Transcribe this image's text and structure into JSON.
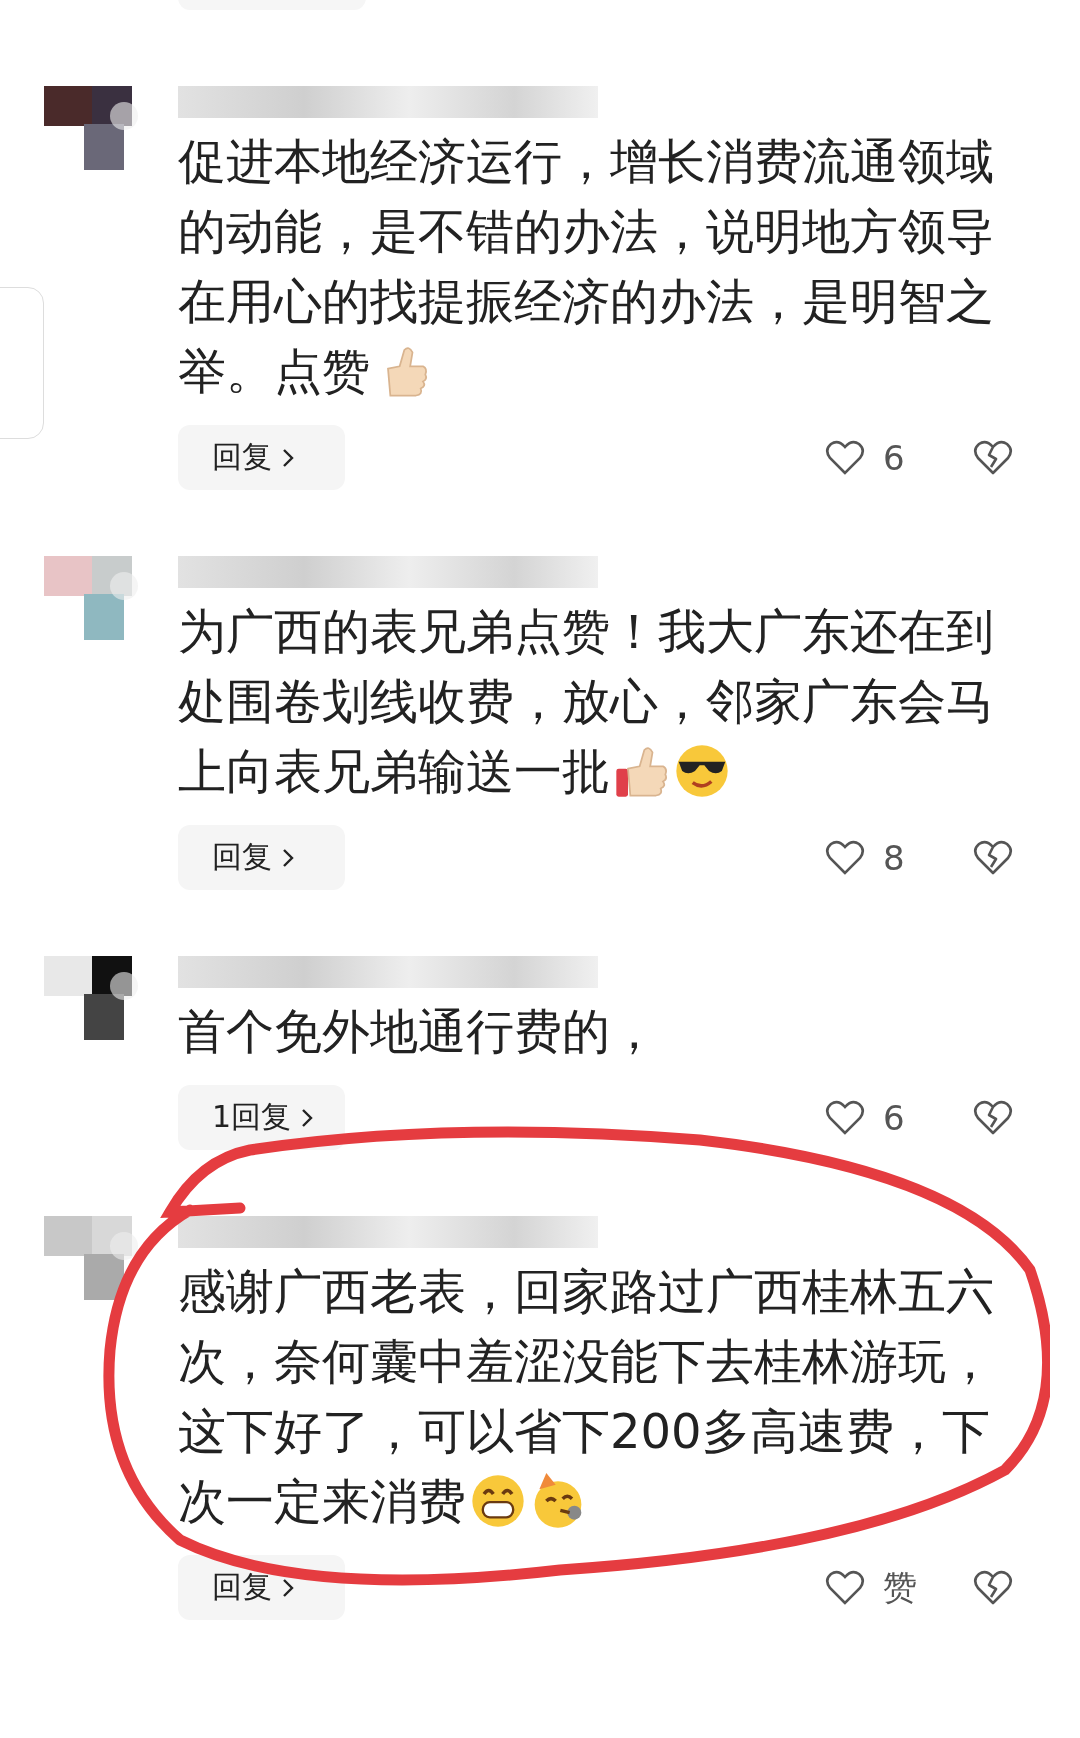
{
  "comments": [
    {
      "lines": [
        "促进本地经济运行，增长消费流通领域",
        "的动能，是不错的办法，说明地方领导",
        "在用心的找提振经济的办法，是明智之",
        "举。点赞"
      ],
      "emojis": [
        {
          "kind": "thumbs-up"
        }
      ],
      "reply": "回复",
      "likes": "6"
    },
    {
      "lines": [
        "为广西的表兄弟点赞！我大广东还在到",
        "处围卷划线收费，放心，邻家广东会马",
        "上向表兄弟输送一批"
      ],
      "emojis": [
        {
          "kind": "thumbs-up"
        },
        {
          "kind": "sunglasses"
        }
      ],
      "reply": "回复",
      "likes": "8"
    },
    {
      "lines": [
        "首个免外地通行费的，"
      ],
      "reply": "1回复",
      "likes": "6"
    },
    {
      "lines": [
        "感谢广西老表，回家路过广西桂林五六",
        "次，奈何囊中羞涩没能下去桂林游玩，",
        "这下好了，可以省下200多高速费，下",
        "次一定来消费"
      ],
      "emojis": [
        {
          "kind": "grin"
        },
        {
          "kind": "party"
        }
      ],
      "reply": "回复",
      "likes": "赞"
    }
  ]
}
